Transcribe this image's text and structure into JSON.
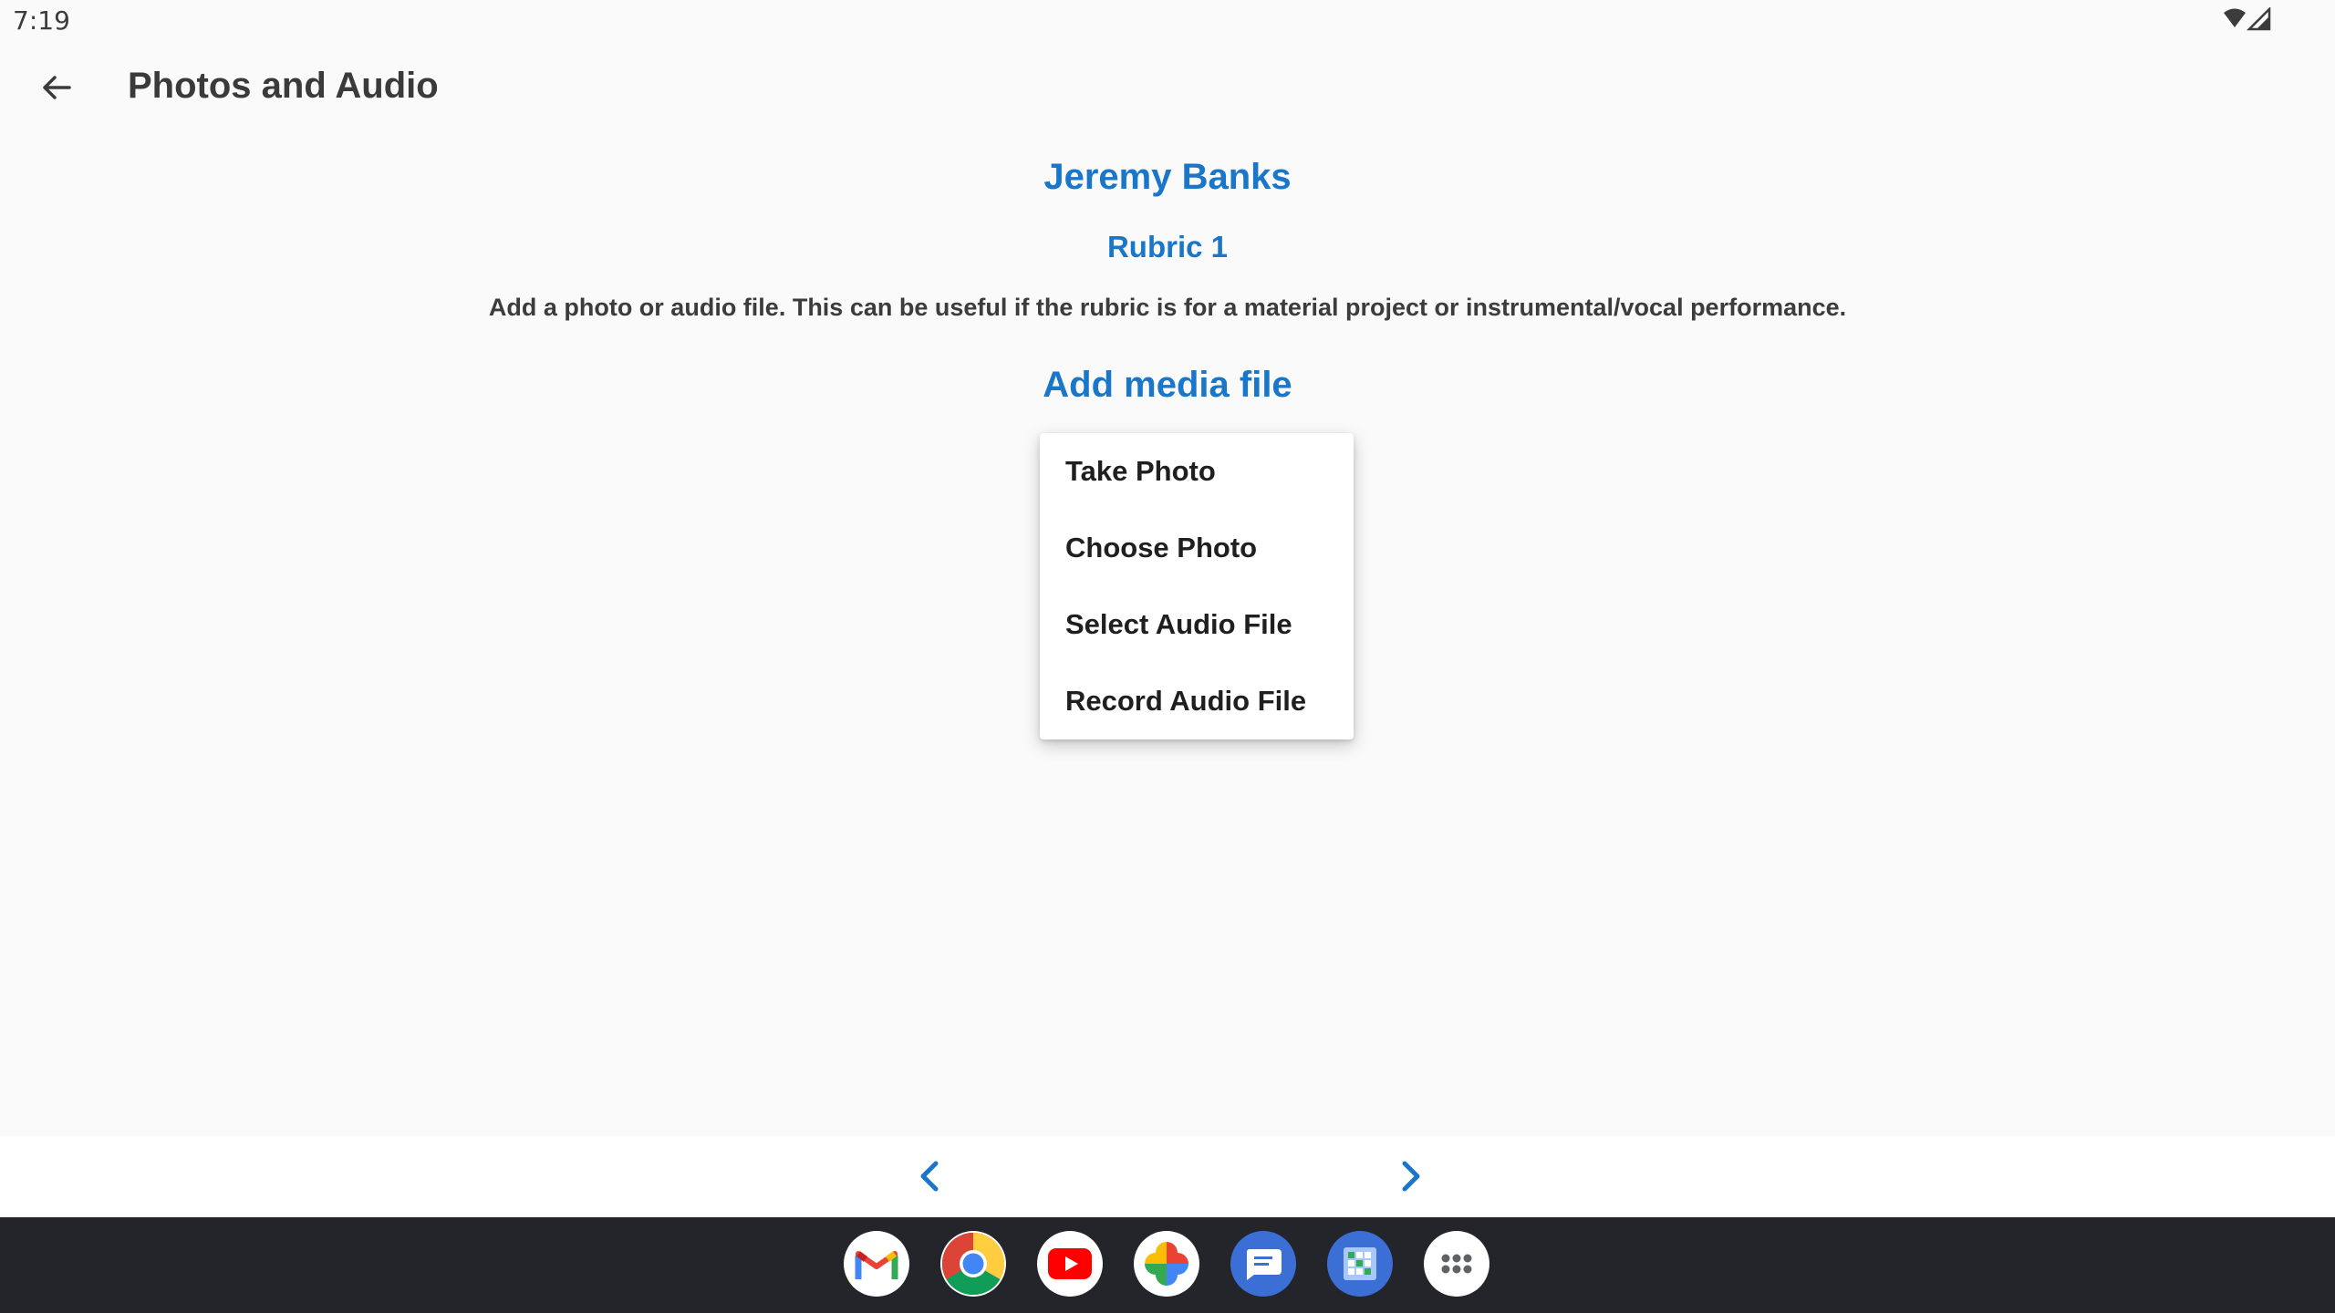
{
  "status_bar": {
    "time": "7:19",
    "icons": [
      "wifi-icon",
      "signal-icon"
    ]
  },
  "app_bar": {
    "back_icon": "arrow-back-icon",
    "title": "Photos and Audio"
  },
  "content": {
    "student_name": "Jeremy Banks",
    "rubric_name": "Rubric 1",
    "description": "Add a photo or audio file. This can be useful if the rubric is for a material project or instrumental/vocal performance.",
    "add_media_label": "Add media file"
  },
  "popup_menu": {
    "items": [
      {
        "label": "Take Photo"
      },
      {
        "label": "Choose Photo"
      },
      {
        "label": "Select Audio File"
      },
      {
        "label": "Record Audio File"
      }
    ]
  },
  "bottom_nav": {
    "prev_icon": "chevron-left-icon",
    "next_icon": "chevron-right-icon"
  },
  "taskbar": {
    "apps": [
      "gmail-icon",
      "chrome-icon",
      "youtube-icon",
      "photos-icon",
      "messages-icon",
      "sheets-icon",
      "app-drawer-icon"
    ]
  },
  "colors": {
    "accent": "#1976c8",
    "background": "#fafafa",
    "taskbar": "#24252a",
    "text_dark": "#3a3a3a"
  }
}
